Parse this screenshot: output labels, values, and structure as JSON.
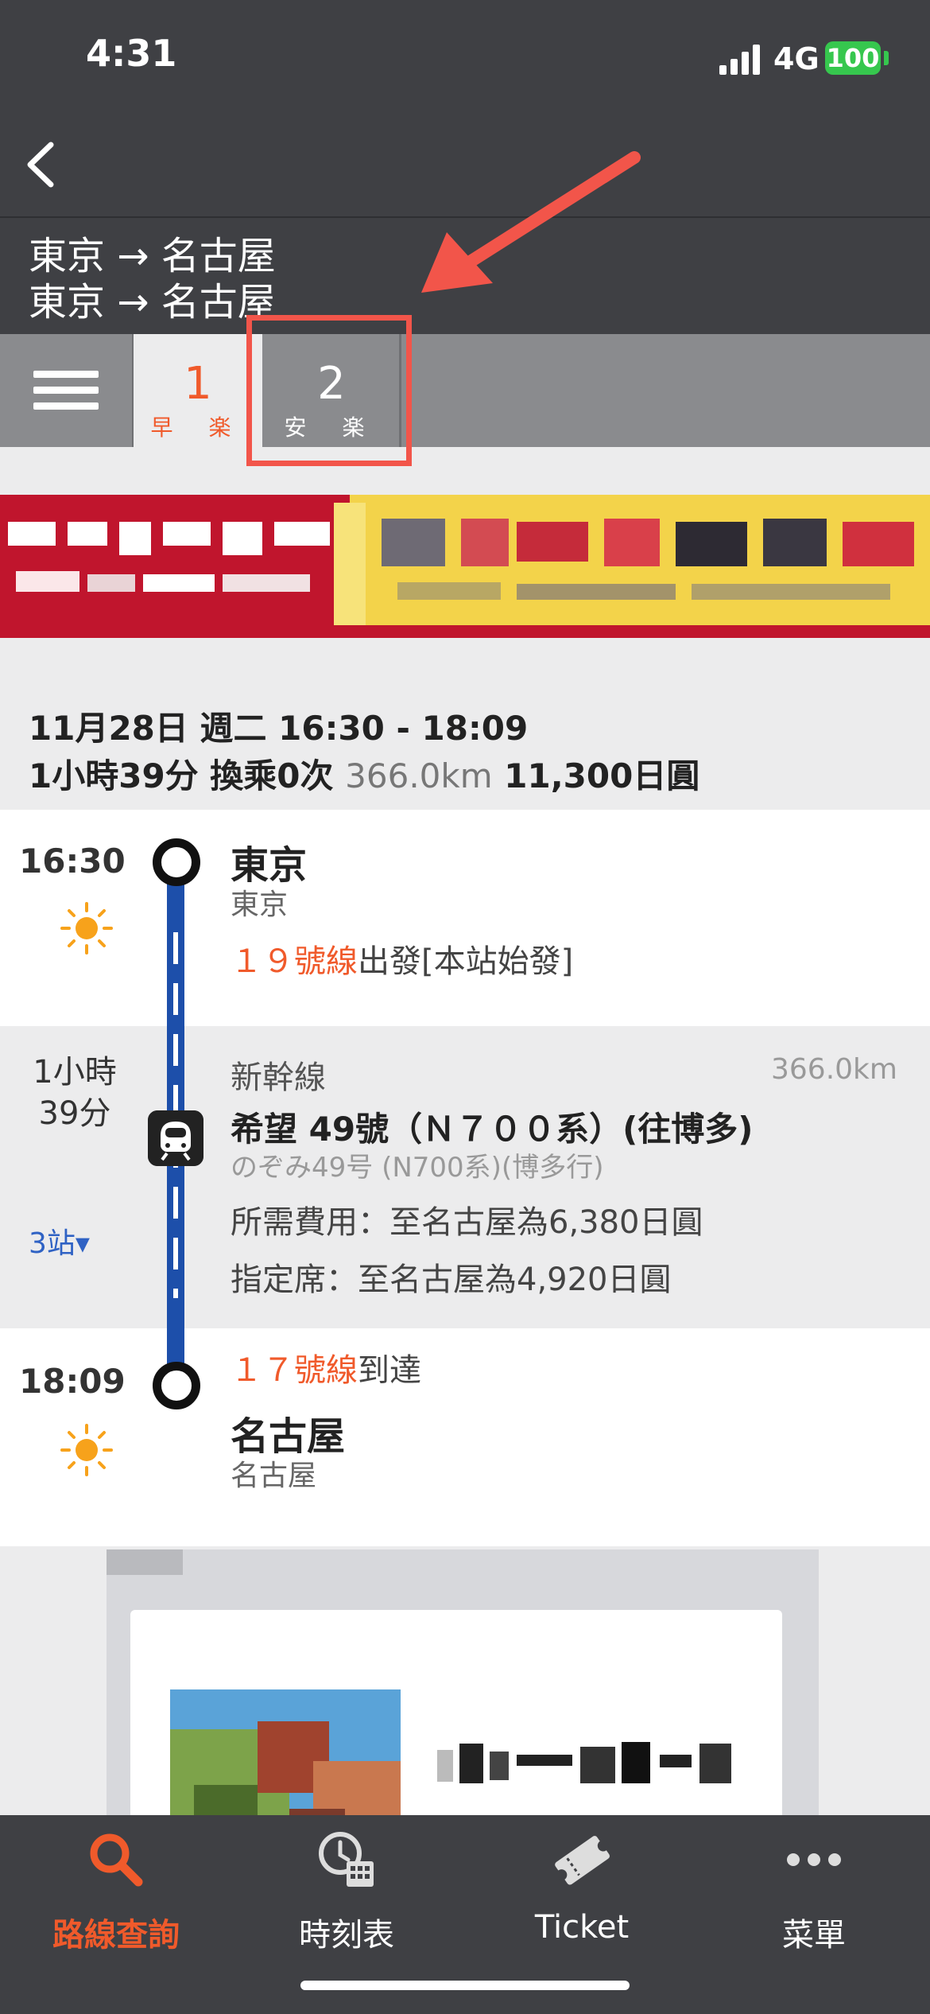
{
  "status_bar": {
    "time": "4:31",
    "network": "4G",
    "battery": "100"
  },
  "header": {
    "route_line_1": "東京 → 名古屋",
    "route_line_2": "東京 → 名古屋"
  },
  "tabs": [
    {
      "number": "1",
      "label": "早 楽"
    },
    {
      "number": "2",
      "label": "安 楽"
    }
  ],
  "trip": {
    "date_time": "11月28日 週二 16:30 - 18:09",
    "duration": "1小時39分",
    "transfers": "換乘0次",
    "distance": "366.0km",
    "fare": "11,300日圓"
  },
  "departure": {
    "time": "16:30",
    "station": "東京",
    "station_sub": "東京",
    "platform_num": "１９號線",
    "platform_text": "出發[本站始發]"
  },
  "ride": {
    "duration_line_1": "1小時",
    "duration_line_2": "39分",
    "stops": "3站▾",
    "line_name": "新幹線",
    "distance": "366.0km",
    "train_name": "希望 49號（Ｎ７００系）(往博多)",
    "train_sub": "のぞみ49号 (N700系)(博多行)",
    "fare_required": "所需費用：至名古屋為6,380日圓",
    "fare_reserved": "指定席：至名古屋為4,920日圓"
  },
  "arrival": {
    "time": "18:09",
    "platform_num": "１７號線",
    "platform_text": "到達",
    "station": "名古屋",
    "station_sub": "名古屋"
  },
  "bottom_nav": [
    {
      "label": "路線查詢",
      "icon": "search-icon"
    },
    {
      "label": "時刻表",
      "icon": "timetable-icon"
    },
    {
      "label": "Ticket",
      "icon": "ticket-icon"
    },
    {
      "label": "菜單",
      "icon": "more-icon"
    }
  ],
  "colors": {
    "accent": "#f05a2b",
    "timeline": "#1d4faa",
    "highlight": "#f2554a",
    "header": "#3f4044"
  }
}
